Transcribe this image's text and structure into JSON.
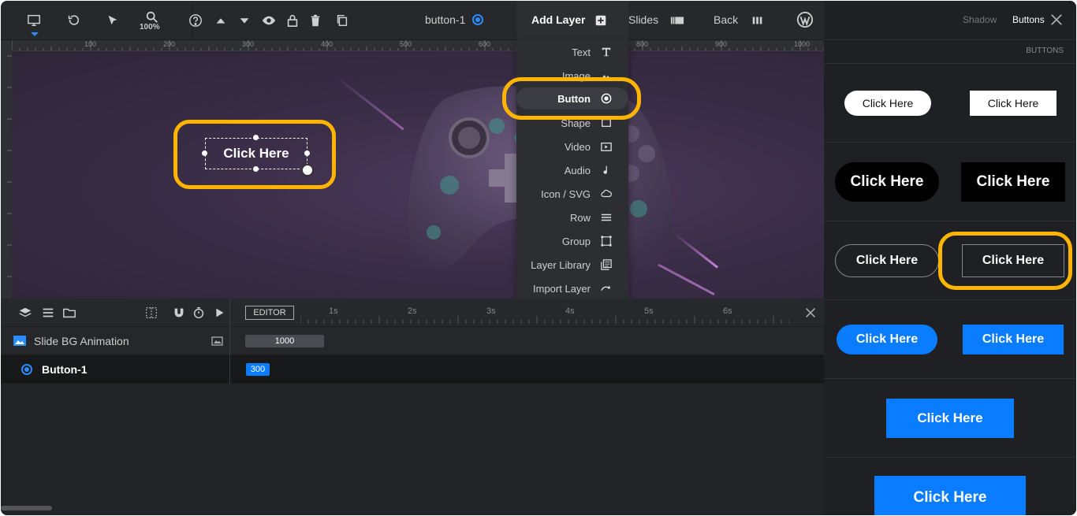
{
  "toolbar": {
    "zoom_label": "100%",
    "layer_name": "button-1",
    "add_layer_label": "Add Layer",
    "slides_label": "Slides",
    "back_label": "Back"
  },
  "ruler": {
    "marks": [
      "100",
      "200",
      "300",
      "400",
      "500",
      "600",
      "700",
      "800",
      "900",
      "1000"
    ]
  },
  "canvas": {
    "selected_button_text": "Click Here"
  },
  "add_layer_menu": {
    "items": [
      {
        "label": "Text",
        "icon": "text-icon"
      },
      {
        "label": "Image",
        "icon": "image-icon"
      },
      {
        "label": "Button",
        "icon": "button-icon"
      },
      {
        "label": "Shape",
        "icon": "shape-icon"
      },
      {
        "label": "Video",
        "icon": "video-icon"
      },
      {
        "label": "Audio",
        "icon": "audio-icon"
      },
      {
        "label": "Icon / SVG",
        "icon": "cloud-icon"
      },
      {
        "label": "Row",
        "icon": "row-icon"
      },
      {
        "label": "Group",
        "icon": "group-icon"
      },
      {
        "label": "Layer Library",
        "icon": "library-icon"
      },
      {
        "label": "Import Layer",
        "icon": "import-icon"
      }
    ],
    "active_item": "Button"
  },
  "timeline": {
    "editor_label": "EDITOR",
    "time_marks": [
      "1s",
      "2s",
      "3s",
      "4s",
      "5s",
      "6s"
    ],
    "rows": [
      {
        "label": "Slide BG Animation",
        "bar_value": "1000"
      },
      {
        "label": "Button-1",
        "bar_value": "300"
      }
    ]
  },
  "right_panel": {
    "tab_shadow": "Shadow",
    "tab_buttons": "Buttons",
    "section_title": "BUTTONS",
    "presets": [
      {
        "row": 1,
        "left": "Click Here",
        "right": "Click Here"
      },
      {
        "row": 2,
        "left": "Click Here",
        "right": "Click Here"
      },
      {
        "row": 3,
        "left": "Click Here",
        "right": "Click Here"
      },
      {
        "row": 4,
        "left": "Click Here",
        "right": "Click Here"
      },
      {
        "row": 5,
        "center": "Click Here"
      },
      {
        "row": 6,
        "center": "Click Here"
      }
    ]
  },
  "colors": {
    "accent_blue": "#0a7cff",
    "highlight": "#ffb400",
    "panel_bg": "#1f2023"
  }
}
